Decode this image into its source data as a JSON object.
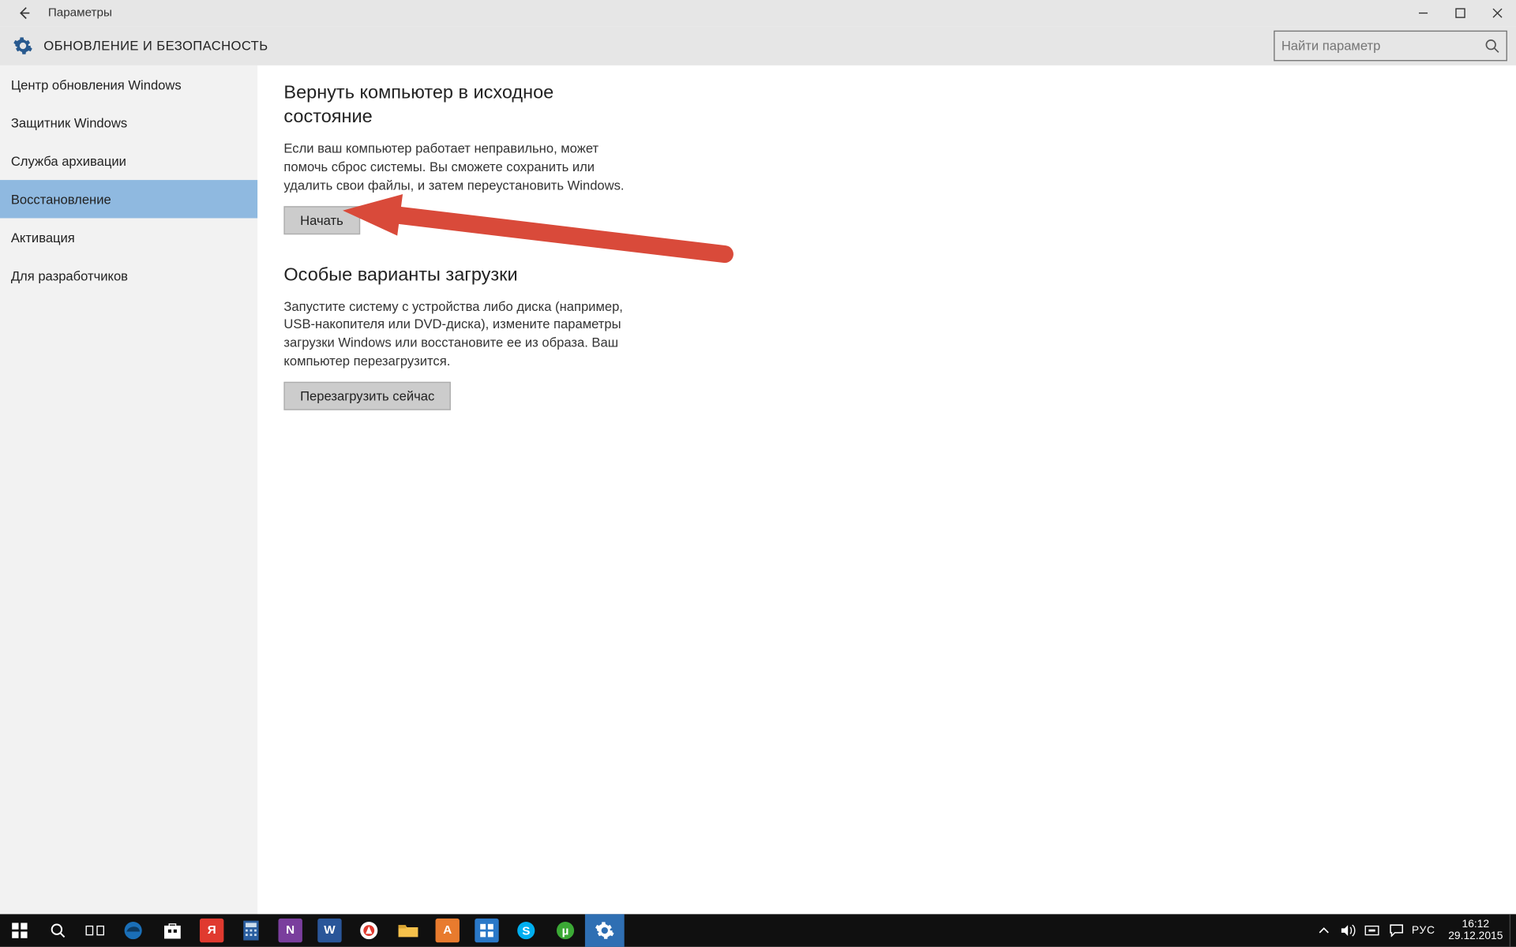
{
  "window": {
    "title": "Параметры"
  },
  "section": {
    "title": "ОБНОВЛЕНИЕ И БЕЗОПАСНОСТЬ"
  },
  "search": {
    "placeholder": "Найти параметр"
  },
  "sidebar": {
    "items": [
      {
        "label": "Центр обновления Windows",
        "selected": false
      },
      {
        "label": "Защитник Windows",
        "selected": false
      },
      {
        "label": "Служба архивации",
        "selected": false
      },
      {
        "label": "Восстановление",
        "selected": true
      },
      {
        "label": "Активация",
        "selected": false
      },
      {
        "label": "Для разработчиков",
        "selected": false
      }
    ]
  },
  "main": {
    "reset": {
      "heading": "Вернуть компьютер в исходное состояние",
      "description": "Если ваш компьютер работает неправильно, может помочь сброс системы. Вы сможете сохранить или удалить свои файлы, и затем переустановить Windows.",
      "button": "Начать"
    },
    "advanced": {
      "heading": "Особые варианты загрузки",
      "description": "Запустите систему с устройства либо диска (например, USB-накопителя или DVD-диска), измените параметры загрузки Windows или восстановите ее из образа. Ваш компьютер перезагрузится.",
      "button": "Перезагрузить сейчас"
    }
  },
  "taskbar": {
    "lang": "РУС",
    "time": "16:12",
    "date": "29.12.2015"
  },
  "colors": {
    "sidebar_selected": "#8fb9e0",
    "button_bg": "#cccccc",
    "arrow": "#d94a3a"
  }
}
